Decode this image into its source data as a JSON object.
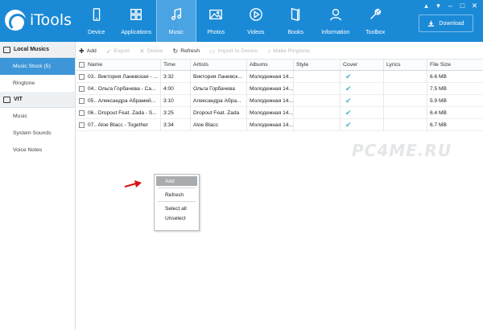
{
  "app": {
    "name": "iTools"
  },
  "nav": [
    {
      "label": "Device",
      "icon": "phone-icon"
    },
    {
      "label": "Applications",
      "icon": "grid-icon"
    },
    {
      "label": "Music",
      "icon": "music-note-icon",
      "active": true
    },
    {
      "label": "Photos",
      "icon": "picture-icon"
    },
    {
      "label": "Videos",
      "icon": "play-icon"
    },
    {
      "label": "Books",
      "icon": "book-icon"
    },
    {
      "label": "Information",
      "icon": "person-icon"
    },
    {
      "label": "Toolbox",
      "icon": "wrench-icon"
    }
  ],
  "download": {
    "label": "Download"
  },
  "window_controls": [
    "▴",
    "▾",
    "–",
    "□",
    "✕"
  ],
  "sidebar": {
    "sections": [
      {
        "title": "Local Musics",
        "items": [
          {
            "label": "Music Stock (5)",
            "active": true
          },
          {
            "label": "Ringtone"
          }
        ]
      },
      {
        "title": "VIT",
        "items": [
          {
            "label": "Music"
          },
          {
            "label": "System Sounds"
          },
          {
            "label": "Voice Notes"
          }
        ]
      }
    ]
  },
  "toolbar": {
    "add": "Add",
    "export": "Export",
    "delete": "Delete",
    "refresh": "Refresh",
    "import": "Import to Device",
    "ringtone": "Make Ringtone"
  },
  "table": {
    "columns": {
      "name": "Name",
      "time": "Time",
      "artist": "Artists",
      "album": "Albums",
      "style": "Style",
      "cover": "Cover",
      "lyrics": "Lyrics",
      "size": "File Size"
    },
    "rows": [
      {
        "name": "03.. Виктория Ланевская - ...",
        "time": "3:32",
        "artist": "Виктория Ланевск...",
        "album": "Молодежная 14...",
        "cover": true,
        "size": "6.6 MB"
      },
      {
        "name": "04.. Ольга Горбачева - Са...",
        "time": "4:00",
        "artist": "Ольга Горбачева",
        "album": "Молодежная 14...",
        "cover": true,
        "size": "7.5 MB"
      },
      {
        "name": "05.. Александра Абрамей...",
        "time": "3:10",
        "artist": "Александра Абра...",
        "album": "Молодежная 14...",
        "cover": true,
        "size": "5.9 MB"
      },
      {
        "name": "06.. Dropout Feat. Zada - S...",
        "time": "3:25",
        "artist": "Dropout Feat. Zada",
        "album": "Молодежная 14...",
        "cover": true,
        "size": "6.4 MB"
      },
      {
        "name": "07.. Aloe Blacc - Together",
        "time": "3:34",
        "artist": "Aloe Blacc",
        "album": "Молодежная 14...",
        "cover": true,
        "size": "6.7 MB"
      }
    ]
  },
  "watermark": "PC4ME.RU",
  "context_menu": {
    "add": "Add",
    "refresh": "Refresh",
    "select_all": "Select all",
    "unselect": "Unselect"
  }
}
